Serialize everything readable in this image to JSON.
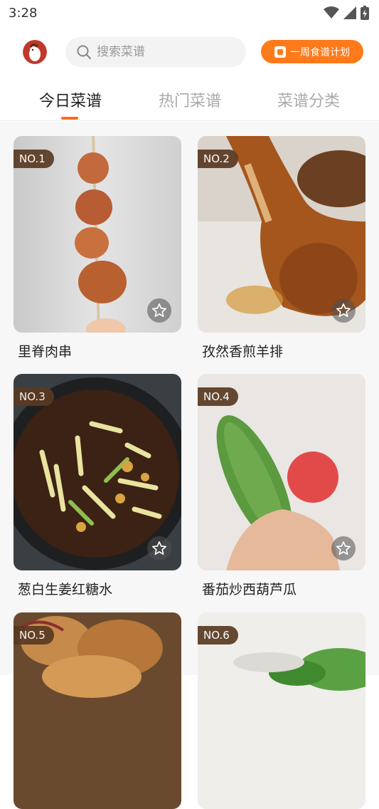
{
  "status_bar": {
    "time": "3:28",
    "wifi_icon": "wifi-icon",
    "signal_icon": "signal-icon",
    "battery_icon": "battery-charging-icon"
  },
  "header": {
    "avatar_icon": "chef-avatar-icon",
    "search": {
      "placeholder": "搜索菜谱",
      "icon": "search-icon"
    },
    "plan_button": {
      "label": "一周食谱计划",
      "icon": "calendar-icon"
    }
  },
  "tabs": [
    {
      "label": "今日菜谱",
      "active": true
    },
    {
      "label": "热门菜谱",
      "active": false
    },
    {
      "label": "菜谱分类",
      "active": false
    }
  ],
  "accent_color": "#ff6a1a",
  "recipes": [
    {
      "rank": "NO.1",
      "name": "里脊肉串"
    },
    {
      "rank": "NO.2",
      "name": "孜然香煎羊排"
    },
    {
      "rank": "NO.3",
      "name": "葱白生姜红糖水"
    },
    {
      "rank": "NO.4",
      "name": "番茄炒西葫芦瓜"
    },
    {
      "rank": "NO.5",
      "name": ""
    },
    {
      "rank": "NO.6",
      "name": ""
    }
  ],
  "favorite_icon": "star-outline-icon"
}
